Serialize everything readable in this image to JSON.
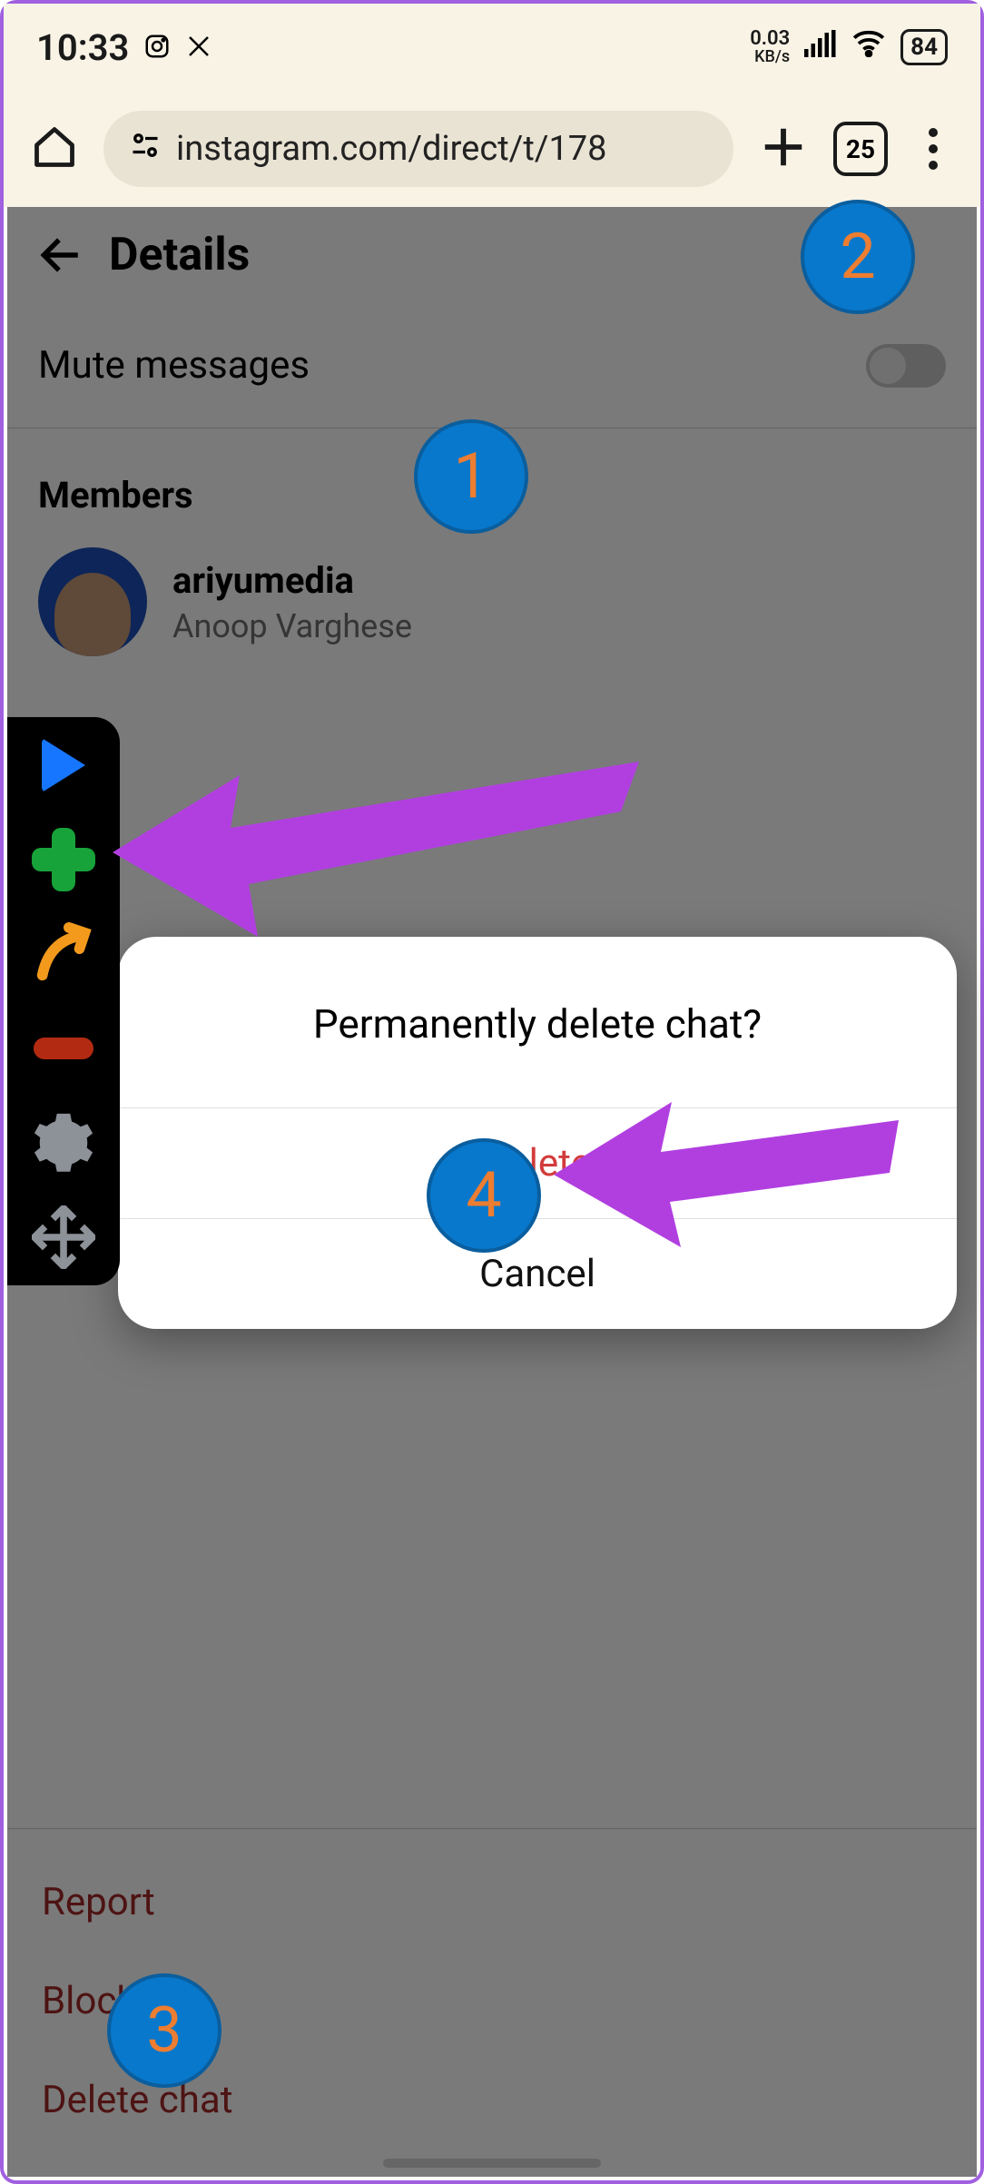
{
  "statusbar": {
    "time": "10:33",
    "kb_rate": "0.03",
    "kb_unit": "KB/s",
    "battery": "84"
  },
  "chrome": {
    "url": "instagram.com/direct/t/178",
    "tab_count": "25"
  },
  "page": {
    "header_title": "Details",
    "mute_label": "Mute messages",
    "members_heading": "Members",
    "member": {
      "username": "ariyumedia",
      "fullname": "Anoop Varghese"
    },
    "links": {
      "report": "Report",
      "block": "Block",
      "delete_chat": "Delete chat"
    }
  },
  "modal": {
    "title": "Permanently delete chat?",
    "delete": "Delete",
    "cancel": "Cancel"
  },
  "annotations": {
    "c1": "1",
    "c2": "2",
    "c3": "3",
    "c4": "4"
  }
}
